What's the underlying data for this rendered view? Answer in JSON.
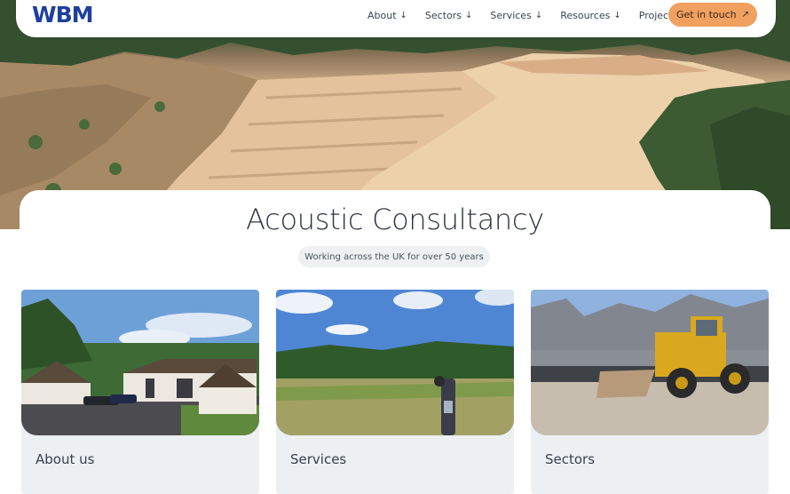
{
  "header": {
    "logo_text": "WBM",
    "nav": [
      {
        "label": "About",
        "has_dropdown": true
      },
      {
        "label": "Sectors",
        "has_dropdown": true
      },
      {
        "label": "Services",
        "has_dropdown": true
      },
      {
        "label": "Resources",
        "has_dropdown": true
      },
      {
        "label": "Projects",
        "has_dropdown": false
      }
    ],
    "cta_label": "Get in touch",
    "cta_color": "#f0a05f",
    "brand_color": "#1f3f9e"
  },
  "hero": {
    "title": "Acoustic Consultancy",
    "tagline": "Working across the UK for over 50 years"
  },
  "cards": [
    {
      "label": "About us"
    },
    {
      "label": "Services"
    },
    {
      "label": "Sectors"
    }
  ],
  "icons": {
    "dropdown": "arrow-down-icon",
    "cta": "arrow-up-right-icon"
  }
}
